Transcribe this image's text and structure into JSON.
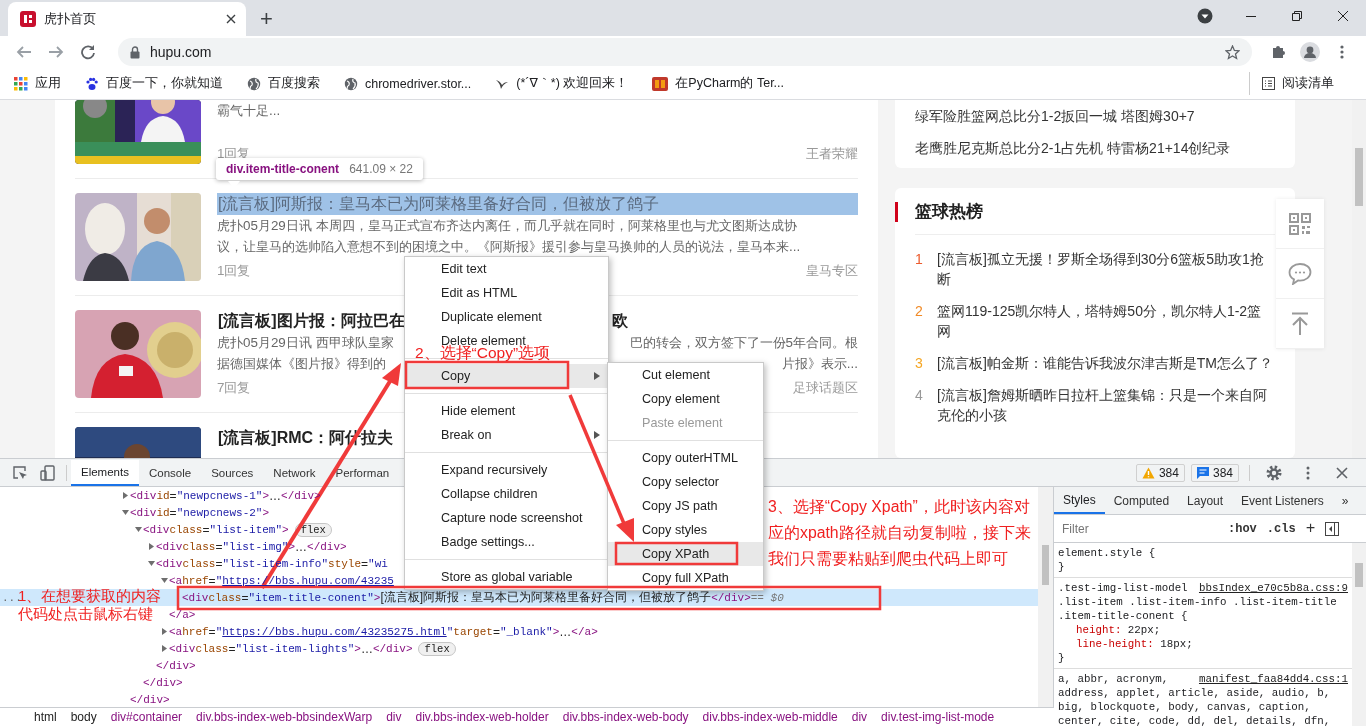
{
  "browser": {
    "tab": {
      "title": "虎扑首页",
      "selected": true
    },
    "new_tab": "+",
    "address": "hupu.com",
    "bookmarks": [
      {
        "kind": "apps",
        "label": "应用"
      },
      {
        "kind": "paw",
        "label": "百度一下，你就知道"
      },
      {
        "kind": "globe",
        "label": "百度搜索"
      },
      {
        "kind": "globe",
        "label": "chromedriver.stor..."
      },
      {
        "kind": "bird",
        "label": "(*´∇｀*) 欢迎回来！"
      },
      {
        "kind": "logo",
        "label": "在PyCharm的 Ter..."
      }
    ],
    "reading_list": "阅读清单"
  },
  "news": [
    {
      "kind": "picture",
      "summary": [
        [
          "霸气十足..."
        ]
      ],
      "replies": "1回复",
      "section": "王者荣耀"
    },
    {
      "kind": "picture",
      "highlighted": true,
      "title": [
        "[流言板]阿斯报：皇马本已为阿莱格里备好合同，但被放了鸽子"
      ],
      "summary": [
        [
          "虎扑05月29日讯 本周四，皇马正式宣布齐达内离任，而几乎就在同时，阿莱格里也与尤文图斯达成协"
        ],
        [
          "议，让皇马的选帅陷入意想不到的困境之中。《阿斯报》援引参与皇马换帅的人员的说法，皇马本来..."
        ]
      ],
      "replies": "1回复",
      "section": "皇马专区"
    },
    {
      "kind": "picture",
      "highlighted": false,
      "title": [
        "[流言板]图片报：阿拉巴在",
        "欧"
      ],
      "summary": [
        [
          "虎扑05月29日讯 西甲球队皇家",
          "巴的转会，双方签下了一份5年合同。根"
        ],
        [
          "据德国媒体《图片报》得到的",
          "片报》表示..."
        ]
      ],
      "replies": "7回复",
      "section": "足球话题区"
    },
    {
      "kind": "picture",
      "highlighted": false,
      "title": [
        "[流言板]RMC：阿什拉夫"
      ]
    }
  ],
  "tooltip": {
    "selector": "div.item-title-conent",
    "size": "641.09 × 22"
  },
  "sidebar": {
    "headlines": [
      "绿军险胜篮网总比分1-2扳回一城 塔图姆30+7",
      "老鹰胜尼克斯总比分2-1占先机 特雷杨21+14创纪录"
    ],
    "hot": {
      "title": "篮球热榜",
      "items": [
        {
          "rank": "1",
          "text": "[流言板]孤立无援！罗斯全场得到30分6篮板5助攻1抢断",
          "color": "#ec5a2c"
        },
        {
          "rank": "2",
          "text": "篮网119-125凯尔特人，塔特姆50分，凯尔特人1-2篮网",
          "color": "#f18a26"
        },
        {
          "rank": "3",
          "text": "[流言板]帕金斯：谁能告诉我波尔津吉斯是TM怎么了？",
          "color": "#f5a623"
        },
        {
          "rank": "4",
          "text": "[流言板]詹姆斯晒昨日拉杆上篮集锦：只是一个来自阿克伦的小孩",
          "color": "#999999"
        }
      ]
    }
  },
  "devtools": {
    "tabs": [
      {
        "label": "Elements",
        "selected": true
      },
      {
        "label": "Console",
        "selected": false
      },
      {
        "label": "Sources",
        "selected": false
      },
      {
        "label": "Network",
        "selected": false
      },
      {
        "label": "Performan",
        "selected": false
      }
    ],
    "warnings": "384",
    "messages": "384",
    "tree": [
      {
        "kind": "collapsed",
        "selected": false,
        "parts": [
          {
            "kind": "tag",
            "text": "<div "
          },
          {
            "kind": "attr",
            "text": "id"
          },
          {
            "kind": "text",
            "text": "="
          },
          {
            "kind": "val",
            "text": "\"newpcnews-1\""
          },
          {
            "kind": "tag",
            "text": ">"
          },
          {
            "kind": "text",
            "text": "…"
          },
          {
            "kind": "tag",
            "text": "</div>"
          }
        ]
      },
      {
        "kind": "expanded",
        "selected": false,
        "parts": [
          {
            "kind": "tag",
            "text": "<div "
          },
          {
            "kind": "attr",
            "text": "id"
          },
          {
            "kind": "text",
            "text": "="
          },
          {
            "kind": "val",
            "text": "\"newpcnews-2\""
          },
          {
            "kind": "tag",
            "text": ">"
          }
        ],
        "closing": [
          {
            "kind": "tag",
            "text": "</div>"
          }
        ],
        "children": [
          {
            "kind": "expanded",
            "selected": false,
            "badge": "flex",
            "parts": [
              {
                "kind": "tag",
                "text": "<div "
              },
              {
                "kind": "attr",
                "text": "class"
              },
              {
                "kind": "text",
                "text": "="
              },
              {
                "kind": "val",
                "text": "\"list-item\""
              },
              {
                "kind": "tag",
                "text": ">"
              }
            ],
            "closing": [
              {
                "kind": "tag",
                "text": "</div>"
              }
            ],
            "children": [
              {
                "kind": "collapsed",
                "selected": false,
                "parts": [
                  {
                    "kind": "tag",
                    "text": "<div "
                  },
                  {
                    "kind": "attr",
                    "text": "class"
                  },
                  {
                    "kind": "text",
                    "text": "="
                  },
                  {
                    "kind": "val",
                    "text": "\"list-img\""
                  },
                  {
                    "kind": "tag",
                    "text": ">"
                  },
                  {
                    "kind": "text",
                    "text": "…"
                  },
                  {
                    "kind": "tag",
                    "text": "</div>"
                  }
                ]
              },
              {
                "kind": "expanded",
                "selected": false,
                "parts": [
                  {
                    "kind": "tag",
                    "text": "<div "
                  },
                  {
                    "kind": "attr",
                    "text": "class"
                  },
                  {
                    "kind": "text",
                    "text": "="
                  },
                  {
                    "kind": "val",
                    "text": "\"list-item-info\""
                  },
                  {
                    "kind": "attr",
                    "text": " style"
                  },
                  {
                    "kind": "text",
                    "text": "="
                  },
                  {
                    "kind": "val",
                    "text": "\"wi"
                  }
                ],
                "closing": [
                  {
                    "kind": "tag",
                    "text": "</div>"
                  }
                ],
                "children": [
                  {
                    "kind": "expanded",
                    "selected": false,
                    "parts": [
                      {
                        "kind": "tag",
                        "text": "<a "
                      },
                      {
                        "kind": "attr",
                        "text": "href"
                      },
                      {
                        "kind": "text",
                        "text": "="
                      },
                      {
                        "kind": "val",
                        "text": "\""
                      },
                      {
                        "kind": "link",
                        "text": "https://bbs.hupu.com/43235"
                      }
                    ],
                    "closing": [
                      {
                        "kind": "tag",
                        "text": "</a>"
                      }
                    ],
                    "children": [
                      {
                        "kind": "leaf",
                        "selected": true,
                        "more": "...",
                        "parts": [
                          {
                            "kind": "tag",
                            "text": "<div "
                          },
                          {
                            "kind": "attr",
                            "text": "class"
                          },
                          {
                            "kind": "text",
                            "text": "="
                          },
                          {
                            "kind": "val",
                            "text": "\"item-title-conent\""
                          },
                          {
                            "kind": "tag",
                            "text": ">"
                          },
                          {
                            "kind": "text",
                            "text": "[流言板]阿斯报：皇马本已为阿莱格里备好合同，但被放了鸽子"
                          },
                          {
                            "kind": "tag",
                            "text": "</div>"
                          },
                          {
                            "kind": "dim",
                            "text": " == $0"
                          }
                        ]
                      }
                    ]
                  },
                  {
                    "kind": "collapsed",
                    "selected": false,
                    "parts": [
                      {
                        "kind": "tag",
                        "text": "<a "
                      },
                      {
                        "kind": "attr",
                        "text": "href"
                      },
                      {
                        "kind": "text",
                        "text": "="
                      },
                      {
                        "kind": "val",
                        "text": "\""
                      },
                      {
                        "kind": "link",
                        "text": "https://bbs.hupu.com/43235275.html"
                      },
                      {
                        "kind": "val",
                        "text": "\""
                      },
                      {
                        "kind": "attr",
                        "text": " target"
                      },
                      {
                        "kind": "text",
                        "text": "="
                      },
                      {
                        "kind": "val",
                        "text": "\"_blank\""
                      },
                      {
                        "kind": "tag",
                        "text": ">"
                      },
                      {
                        "kind": "text",
                        "text": "…"
                      },
                      {
                        "kind": "tag",
                        "text": "</a>"
                      }
                    ]
                  },
                  {
                    "kind": "collapsed",
                    "selected": false,
                    "badge": "flex",
                    "parts": [
                      {
                        "kind": "tag",
                        "text": "<div "
                      },
                      {
                        "kind": "attr",
                        "text": "class"
                      },
                      {
                        "kind": "text",
                        "text": "="
                      },
                      {
                        "kind": "val",
                        "text": "\"list-item-lights\""
                      },
                      {
                        "kind": "tag",
                        "text": ">"
                      },
                      {
                        "kind": "text",
                        "text": "…"
                      },
                      {
                        "kind": "tag",
                        "text": "</div>"
                      }
                    ]
                  }
                ]
              }
            ]
          }
        ]
      }
    ],
    "breadcrumbs": [
      "html",
      "body",
      "div#container",
      "div.bbs-index-web-bbsindexWarp",
      "div",
      "div.bbs-index-web-holder",
      "div.bbs-index-web-body",
      "div.bbs-index-web-middle",
      "div",
      "div.test-img-list-mode"
    ],
    "styles": {
      "tabs": [
        {
          "label": "Styles",
          "selected": true
        },
        {
          "label": "Computed",
          "selected": false
        },
        {
          "label": "Layout",
          "selected": false
        },
        {
          "label": "Event Listeners",
          "selected": false
        }
      ],
      "more_tabs": "»",
      "filter_placeholder": "Filter",
      "hov": ":hov",
      "cls": ".cls",
      "plus": "+",
      "rules": [
        {
          "selectors": [
            "element.style {"
          ],
          "close": "}"
        },
        {
          "selectors": [
            ".test-img-list-model",
            ".list-item .list-item-info .list-item-title",
            ".item-title-conent {"
          ],
          "source": "bbsIndex_e70c5b8a.css:9",
          "declarations": [
            {
              "property": "height:",
              "value": "22px;"
            },
            {
              "property": "line-height:",
              "value": "18px;"
            }
          ],
          "close": "}"
        },
        {
          "selectors": [
            "a, abbr, acronym,",
            "address, applet, article, aside, audio, b,",
            "big, blockquote, body, canvas, caption,",
            "center, cite, code, dd, del, details, dfn,"
          ],
          "source": "manifest_faa84dd4.css:1"
        }
      ]
    }
  },
  "context_menu": {
    "items": [
      {
        "kind": "item",
        "label": "Edit text",
        "selected": false,
        "submenu": false
      },
      {
        "kind": "item",
        "label": "Edit as HTML",
        "selected": false,
        "submenu": false
      },
      {
        "kind": "item",
        "label": "Duplicate element",
        "selected": false,
        "submenu": false
      },
      {
        "kind": "item",
        "label": "Delete element",
        "selected": false,
        "submenu": false
      },
      {
        "kind": "separator"
      },
      {
        "kind": "item",
        "label": "Copy",
        "selected": true,
        "submenu": true
      },
      {
        "kind": "separator"
      },
      {
        "kind": "item",
        "label": "Hide element",
        "selected": false,
        "submenu": false
      },
      {
        "kind": "item",
        "label": "Break on",
        "selected": false,
        "submenu": true
      },
      {
        "kind": "separator"
      },
      {
        "kind": "item",
        "label": "Expand recursively",
        "selected": false,
        "submenu": false
      },
      {
        "kind": "item",
        "label": "Collapse children",
        "selected": false,
        "submenu": false
      },
      {
        "kind": "item",
        "label": "Capture node screenshot",
        "selected": false,
        "submenu": false
      },
      {
        "kind": "item",
        "label": "Badge settings...",
        "selected": false,
        "submenu": false
      },
      {
        "kind": "separator"
      },
      {
        "kind": "item",
        "label": "Store as global variable",
        "selected": false,
        "submenu": false
      }
    ],
    "submenu": [
      {
        "kind": "item",
        "label": "Cut element",
        "selected": false,
        "disabled": false
      },
      {
        "kind": "item",
        "label": "Copy element",
        "selected": false,
        "disabled": false
      },
      {
        "kind": "item",
        "label": "Paste element",
        "selected": false,
        "disabled": true
      },
      {
        "kind": "separator"
      },
      {
        "kind": "item",
        "label": "Copy outerHTML",
        "selected": false,
        "disabled": false
      },
      {
        "kind": "item",
        "label": "Copy selector",
        "selected": false,
        "disabled": false
      },
      {
        "kind": "item",
        "label": "Copy JS path",
        "selected": false,
        "disabled": false
      },
      {
        "kind": "item",
        "label": "Copy styles",
        "selected": false,
        "disabled": false
      },
      {
        "kind": "item",
        "label": "Copy XPath",
        "selected": true,
        "disabled": false
      },
      {
        "kind": "item",
        "label": "Copy full XPath",
        "selected": false,
        "disabled": false
      }
    ]
  },
  "annotations": [
    {
      "kind": "note",
      "text": "1、在想要获取的内容代码处点击鼠标右键"
    },
    {
      "kind": "note",
      "text": "2、选择“Copy”选项"
    },
    {
      "kind": "note",
      "text": "3、选择“Copy Xpath”，此时该内容对应的xpath路径就自动复制啦，接下来我们只需要粘贴到爬虫代码上即可"
    }
  ]
}
